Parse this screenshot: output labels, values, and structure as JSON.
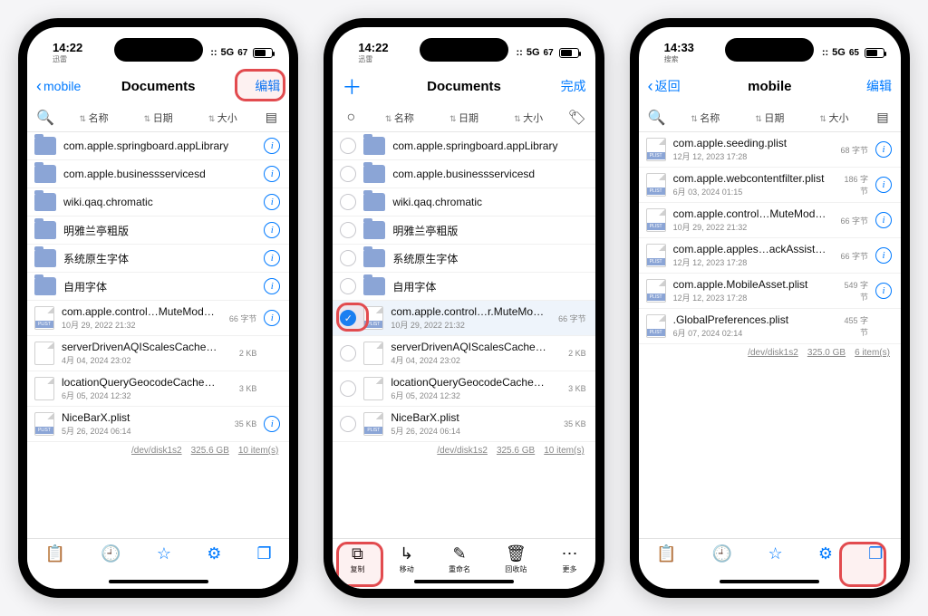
{
  "colors": {
    "accent": "#007aff",
    "highlight": "#e24b4f",
    "folder": "#8ba5d6"
  },
  "screens": [
    {
      "status": {
        "carrier": "迅雷",
        "time": "14:22",
        "network": "5G",
        "battery": "67"
      },
      "nav": {
        "back": "mobile",
        "title": "Documents",
        "right": "编辑"
      },
      "sort": {
        "search": true,
        "cols": [
          "名称",
          "日期",
          "大小"
        ],
        "right": "layout"
      },
      "highlight": "nav-right",
      "items": [
        {
          "kind": "folder",
          "name": "com.apple.springboard.appLibrary",
          "info": true
        },
        {
          "kind": "folder",
          "name": "com.apple.businessservicesd",
          "info": true
        },
        {
          "kind": "folder",
          "name": "wiki.qaq.chromatic",
          "info": true
        },
        {
          "kind": "folder",
          "name": "明雅兰亭粗版",
          "info": true
        },
        {
          "kind": "folder",
          "name": "系统原生字体",
          "info": true
        },
        {
          "kind": "folder",
          "name": "自用字体",
          "info": true
        },
        {
          "kind": "plist",
          "name": "com.apple.control…MuteModule.plist",
          "sub": "10月 29, 2022 21:32",
          "size": "66 字节",
          "info": true
        },
        {
          "kind": "file",
          "name": "serverDrivenAQIScalesCacheFolder",
          "sub": "4月 04, 2024 23:02",
          "size": "2 KB"
        },
        {
          "kind": "file",
          "name": "locationQueryGeocodeCacheFolder",
          "sub": "6月 05, 2024 12:32",
          "size": "3 KB"
        },
        {
          "kind": "plist",
          "name": "NiceBarX.plist",
          "sub": "5月 26, 2024 06:14",
          "size": "35 KB",
          "info": true
        }
      ],
      "path": {
        "mount": "/dev/disk1s2",
        "free": "325.6 GB",
        "count": "10 item(s)"
      },
      "tabbar": {
        "style": "blue",
        "items": [
          "clipboard",
          "clock",
          "star",
          "gear",
          "windows"
        ]
      }
    },
    {
      "status": {
        "carrier": "迅雷",
        "time": "14:22",
        "network": "5G",
        "battery": "67"
      },
      "nav": {
        "left_plus": true,
        "title": "Documents",
        "right": "完成"
      },
      "sort": {
        "select": true,
        "cols": [
          "名称",
          "日期",
          "大小"
        ],
        "right": "tag"
      },
      "highlight_rows": [
        6
      ],
      "highlight_tabbar_idx": 0,
      "items": [
        {
          "sel": false,
          "kind": "folder",
          "name": "com.apple.springboard.appLibrary"
        },
        {
          "sel": false,
          "kind": "folder",
          "name": "com.apple.businessservicesd"
        },
        {
          "sel": false,
          "kind": "folder",
          "name": "wiki.qaq.chromatic"
        },
        {
          "sel": false,
          "kind": "folder",
          "name": "明雅兰亭粗版"
        },
        {
          "sel": false,
          "kind": "folder",
          "name": "系统原生字体"
        },
        {
          "sel": false,
          "kind": "folder",
          "name": "自用字体"
        },
        {
          "sel": true,
          "kind": "plist",
          "name": "com.apple.control…r.MuteModule.plist",
          "sub": "10月 29, 2022 21:32",
          "size": "66 字节"
        },
        {
          "sel": false,
          "kind": "file",
          "name": "serverDrivenAQIScalesCacheFolder",
          "sub": "4月 04, 2024 23:02",
          "size": "2 KB"
        },
        {
          "sel": false,
          "kind": "file",
          "name": "locationQueryGeocodeCacheFolder",
          "sub": "6月 05, 2024 12:32",
          "size": "3 KB"
        },
        {
          "sel": false,
          "kind": "plist",
          "name": "NiceBarX.plist",
          "sub": "5月 26, 2024 06:14",
          "size": "35 KB"
        }
      ],
      "path": {
        "mount": "/dev/disk1s2",
        "free": "325.6 GB",
        "count": "10 item(s)"
      },
      "tabbar": {
        "style": "black",
        "labeled": true,
        "items": [
          {
            "icon": "copy",
            "label": "复制"
          },
          {
            "icon": "move",
            "label": "移动"
          },
          {
            "icon": "rename",
            "label": "重命名"
          },
          {
            "icon": "trash",
            "label": "回收站"
          },
          {
            "icon": "more",
            "label": "更多"
          }
        ]
      }
    },
    {
      "status": {
        "carrier": "搜索",
        "time": "14:33",
        "network": "5G",
        "battery": "65"
      },
      "nav": {
        "back": "返回",
        "title": "mobile",
        "right": "编辑"
      },
      "sort": {
        "search": true,
        "cols": [
          "名称",
          "日期",
          "大小"
        ],
        "right": "layout"
      },
      "highlight_tabbar_idx": 4,
      "items": [
        {
          "kind": "plist",
          "name": "com.apple.seeding.plist",
          "sub": "12月 12, 2023 17:28",
          "size": "68 字节",
          "info": true
        },
        {
          "kind": "plist",
          "name": "com.apple.webcontentfilter.plist",
          "sub": "6月 03, 2024 01:15",
          "size": "186 字节",
          "info": true
        },
        {
          "kind": "plist",
          "name": "com.apple.control…MuteModule.plist",
          "sub": "10月 29, 2022 21:32",
          "size": "66 字节",
          "info": true
        },
        {
          "kind": "plist",
          "name": "com.apple.apples…ackAssistant.plist",
          "sub": "12月 12, 2023 17:28",
          "size": "66 字节",
          "info": true
        },
        {
          "kind": "plist",
          "name": "com.apple.MobileAsset.plist",
          "sub": "12月 12, 2023 17:28",
          "size": "549 字节",
          "info": true
        },
        {
          "kind": "plist",
          "name": ".GlobalPreferences.plist",
          "sub": "6月 07, 2024 02:14",
          "size": "455 字节"
        }
      ],
      "path": {
        "mount": "/dev/disk1s2",
        "free": "325.0 GB",
        "count": "6 item(s)"
      },
      "tabbar": {
        "style": "blue",
        "items": [
          "clipboard",
          "clock",
          "star",
          "gear",
          "windows"
        ]
      }
    }
  ]
}
